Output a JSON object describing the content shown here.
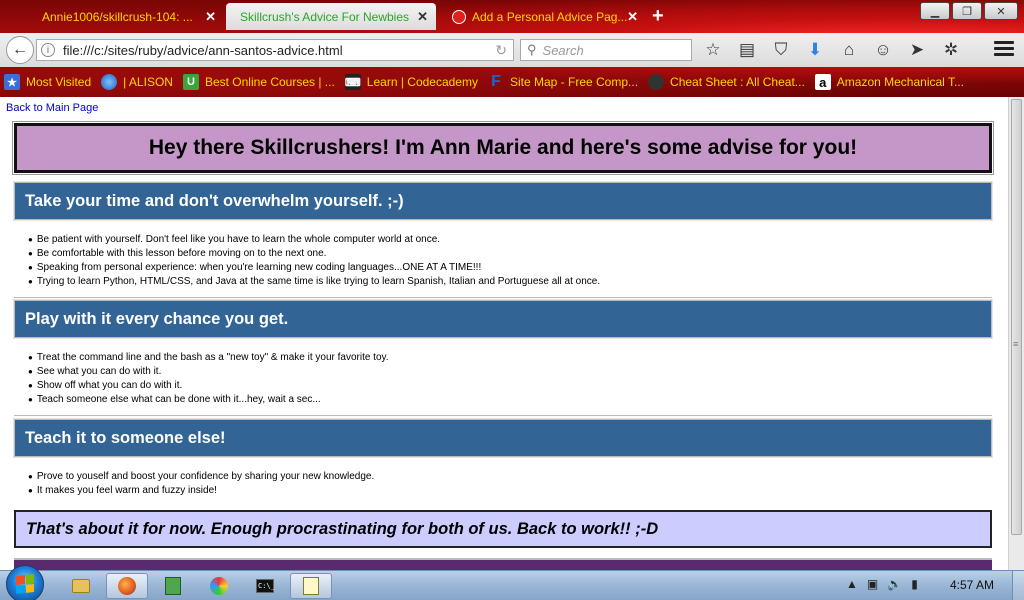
{
  "browser": {
    "tabs": [
      {
        "label": "Annie1006/skillcrush-104: ...",
        "active": false
      },
      {
        "label": "Skillcrush's Advice For Newbies",
        "active": true
      },
      {
        "label": "Add a Personal Advice Pag...",
        "active": false
      }
    ],
    "url": "file:///c:/sites/ruby/advice/ann-santos-advice.html",
    "search_placeholder": "Search",
    "bookmarks": [
      {
        "label": "Most Visited",
        "icon": "most-visited-icon"
      },
      {
        "label": "| ALISON",
        "icon": "globe-icon"
      },
      {
        "label": "Best Online Courses | ...",
        "icon": "udemy-icon"
      },
      {
        "label": "Learn | Codecademy",
        "icon": "codecademy-icon"
      },
      {
        "label": "Site Map - Free Comp...",
        "icon": "f-icon"
      },
      {
        "label": "Cheat Sheet : All Cheat...",
        "icon": "cheatsheet-icon"
      },
      {
        "label": "Amazon Mechanical T...",
        "icon": "amazon-icon"
      }
    ]
  },
  "page": {
    "back_link": "Back to Main Page",
    "hero": "Hey there Skillcrushers! I'm Ann Marie and here's some advise for you!",
    "sections": [
      {
        "heading": "Take your time and don't overwhelm yourself. ;-)",
        "items": [
          "Be patient with yourself. Don't feel like you have to learn the whole computer world at once.",
          "Be comfortable with this lesson before moving on to the next one.",
          "Speaking from personal experience: when you're learning new coding languages...ONE AT A TIME!!!",
          "Trying to learn Python, HTML/CSS, and Java at the same time is like trying to learn Spanish, Italian and Portuguese all at once."
        ]
      },
      {
        "heading": "Play with it every chance you get.",
        "items": [
          "Treat the command line and the bash as a \"new toy\" & make it your favorite toy.",
          "See what you can do with it.",
          "Show off what you can do with it.",
          "Teach someone else what can be done with it...hey, wait a sec..."
        ]
      },
      {
        "heading": "Teach it to someone else!",
        "items": [
          "Prove to youself and boost your confidence by sharing your new knowledge.",
          "It makes you feel warm and fuzzy inside!"
        ]
      }
    ],
    "closing": "That's about it for now. Enough procrastinating for both of us. Back to work!! ;-D"
  },
  "taskbar": {
    "clock": "4:57 AM",
    "cmd_label": "C:\\_"
  },
  "colors": {
    "hero_bg": "#c597c8",
    "section_bg": "#326496",
    "closing_bg": "#ccccff",
    "tab_text": "#ffd700"
  }
}
